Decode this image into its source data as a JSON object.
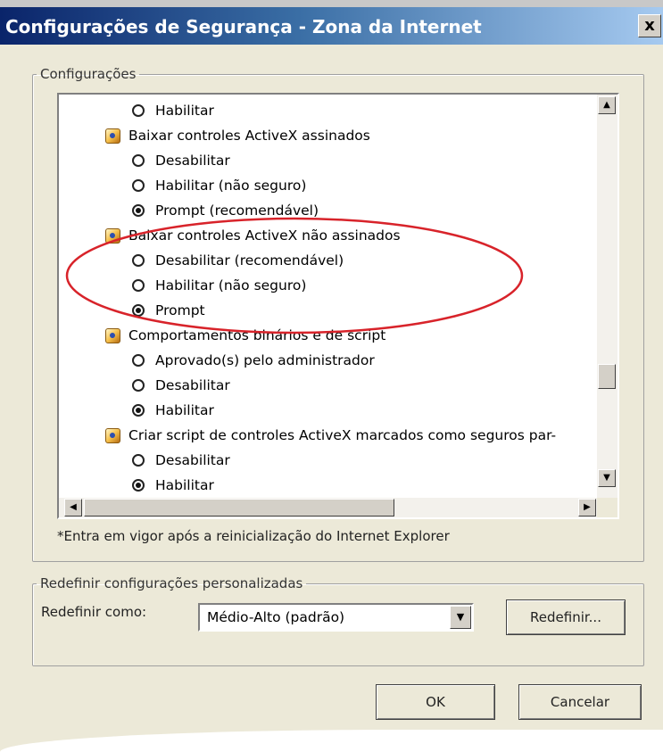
{
  "window": {
    "title": "Configurações de Segurança - Zona da Internet",
    "close_label": "x"
  },
  "settings": {
    "legend": "Configurações",
    "items": [
      {
        "type": "option",
        "label": "Habilitar",
        "selected": false
      },
      {
        "type": "category",
        "label": "Baixar controles ActiveX assinados",
        "icon": "activex-settings-icon"
      },
      {
        "type": "option",
        "label": "Desabilitar",
        "selected": false
      },
      {
        "type": "option",
        "label": "Habilitar (não seguro)",
        "selected": false
      },
      {
        "type": "option",
        "label": "Prompt (recomendável)",
        "selected": true
      },
      {
        "type": "category",
        "label": "Baixar controles ActiveX não assinados",
        "icon": "activex-settings-icon"
      },
      {
        "type": "option",
        "label": "Desabilitar (recomendável)",
        "selected": false
      },
      {
        "type": "option",
        "label": "Habilitar (não seguro)",
        "selected": false
      },
      {
        "type": "option",
        "label": "Prompt",
        "selected": true
      },
      {
        "type": "category",
        "label": "Comportamentos binários e de script",
        "icon": "activex-settings-icon"
      },
      {
        "type": "option",
        "label": "Aprovado(s) pelo administrador",
        "selected": false
      },
      {
        "type": "option",
        "label": "Desabilitar",
        "selected": false
      },
      {
        "type": "option",
        "label": "Habilitar",
        "selected": true
      },
      {
        "type": "category",
        "label": "Criar script de controles ActiveX marcados como seguros par-",
        "icon": "activex-settings-icon"
      },
      {
        "type": "option",
        "label": "Desabilitar",
        "selected": false
      },
      {
        "type": "option",
        "label": "Habilitar",
        "selected": true
      }
    ],
    "note": "*Entra em vigor após a reinicialização do Internet Explorer",
    "annotation_color": "#d8232a"
  },
  "reset": {
    "legend": "Redefinir configurações personalizadas",
    "label": "Redefinir como:",
    "selected_value": "Médio-Alto (padrão)",
    "button": "Redefinir..."
  },
  "footer": {
    "ok": "OK",
    "cancel": "Cancelar"
  }
}
